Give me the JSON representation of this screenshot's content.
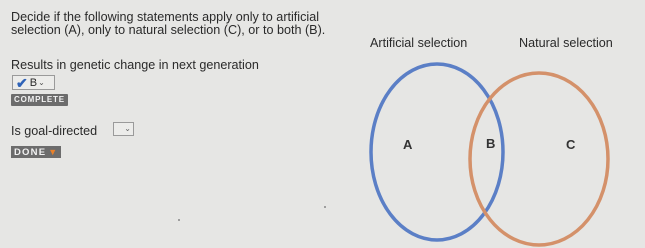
{
  "instructions": "Decide if the following statements apply only to artificial selection (A), only to natural selection (C), or to both (B).",
  "statements": [
    {
      "text": "Results in genetic change in next generation",
      "answer": "B",
      "answer_chevron": "⌄",
      "status_badge": "COMPLETE",
      "check_icon": "✔"
    },
    {
      "text": "Is goal-directed",
      "answer": "",
      "answer_chevron": "⌄",
      "status_badge": "DONE",
      "status_chevron": "▼"
    }
  ],
  "venn": {
    "left_label": "Artificial selection",
    "right_label": "Natural selection",
    "regions": [
      "A",
      "B",
      "C"
    ],
    "left_circle_color": "#5b7fc6",
    "right_circle_color": "#d4916a"
  },
  "colors": {
    "background": "#e6e6e4",
    "badge_bg": "#6c6c6c",
    "check": "#2f63b8",
    "done_chevron": "#e8802a"
  }
}
